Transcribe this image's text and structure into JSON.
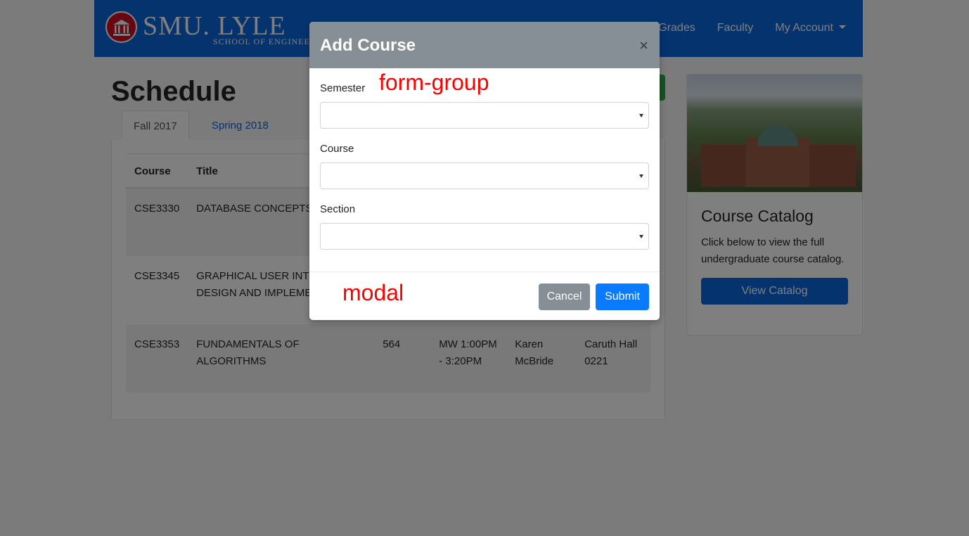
{
  "nav": {
    "logo_main": "SMU. LYLE",
    "logo_sub": "SCHOOL OF ENGINEERING",
    "links": [
      "Grades",
      "Faculty",
      "My Account"
    ]
  },
  "page": {
    "title": "Schedule"
  },
  "tabs": [
    "Fall 2017",
    "Spring 2018"
  ],
  "table": {
    "headers": [
      "Course",
      "Title"
    ],
    "rows": [
      {
        "course": "CSE3330",
        "title": "DATABASE CONCEPTS",
        "section": "",
        "time": "",
        "instructor": "",
        "room": ""
      },
      {
        "course": "CSE3345",
        "title": "GRAPHICAL USER INTERFACE DESIGN AND IMPLEMENTATION",
        "section": "",
        "time": "",
        "instructor": "",
        "room": ""
      },
      {
        "course": "CSE3353",
        "title": "FUNDAMENTALS OF ALGORITHMS",
        "section": "564",
        "time": "MW 1:00PM - 3:20PM",
        "instructor": "Karen McBride",
        "room": "Caruth Hall 0221"
      }
    ]
  },
  "catalog": {
    "title": "Course Catalog",
    "text": "Click below to view the full undergraduate course catalog.",
    "button": "View Catalog"
  },
  "modal": {
    "title": "Add Course",
    "close": "×",
    "fields": [
      {
        "label": "Semester",
        "value": ""
      },
      {
        "label": "Course",
        "value": ""
      },
      {
        "label": "Section",
        "value": ""
      }
    ],
    "cancel": "Cancel",
    "submit": "Submit"
  },
  "annotations": {
    "form_group": "form-group",
    "modal": "modal"
  },
  "colors": {
    "primary": "#0a66dc",
    "success": "#28a745",
    "secondary": "#868e96",
    "annotation": "#ff0000"
  }
}
